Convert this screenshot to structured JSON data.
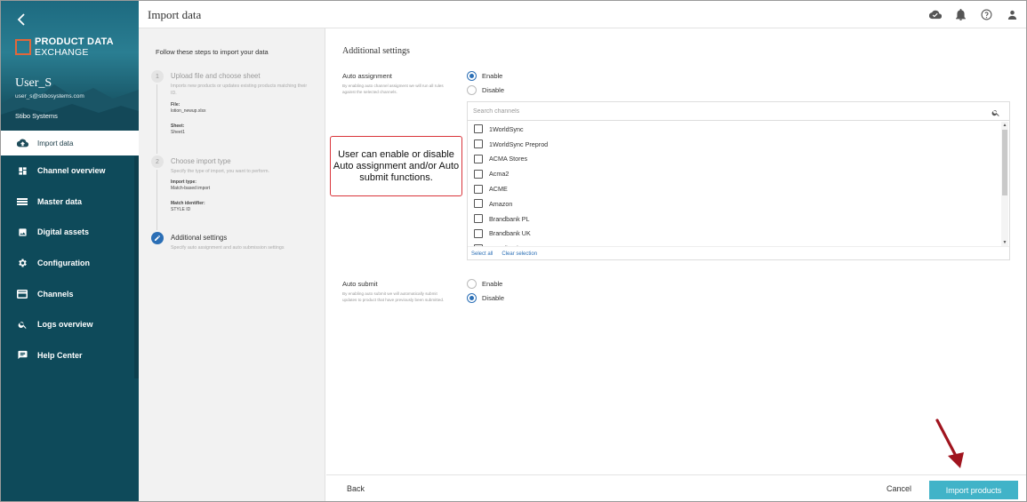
{
  "sidebar": {
    "logo": {
      "line1": "PRODUCT DATA",
      "line2": "EXCHANGE",
      "accent": "#e2673a"
    },
    "user": {
      "name": "User_S",
      "email": "user_s@stibosystems.com",
      "org": "Stibo Systems"
    },
    "items": [
      {
        "label": "Import data",
        "icon": "cloud-upload-icon",
        "active": true
      },
      {
        "label": "Channel overview",
        "icon": "dashboard-icon"
      },
      {
        "label": "Master data",
        "icon": "list-icon"
      },
      {
        "label": "Digital assets",
        "icon": "image-icon"
      },
      {
        "label": "Configuration",
        "icon": "gear-icon"
      },
      {
        "label": "Channels",
        "icon": "card-icon"
      },
      {
        "label": "Logs overview",
        "icon": "search-icon"
      },
      {
        "label": "Help Center",
        "icon": "chat-icon"
      }
    ]
  },
  "header": {
    "title": "Import data"
  },
  "steps": {
    "title": "Follow these steps to import your data",
    "items": [
      {
        "num": "1",
        "title": "Upload file and choose sheet",
        "desc": "Imports new products or updates existing products matching their ID.",
        "fields": [
          {
            "label": "File:",
            "value": "lotion_newup.xlsx"
          },
          {
            "label": "Sheet:",
            "value": "Sheet1"
          }
        ]
      },
      {
        "num": "2",
        "title": "Choose import type",
        "desc": "Specify the type of import, you want to perform.",
        "fields": [
          {
            "label": "Import type:",
            "value": "Match-based import"
          },
          {
            "label": "Match identifier:",
            "value": "STYLE ID"
          }
        ]
      },
      {
        "title": "Additional settings",
        "desc": "Specify auto assignment and auto submission settings"
      }
    ]
  },
  "main": {
    "section_title": "Additional settings",
    "auto_assignment": {
      "label": "Auto assignment",
      "desc": "By enabling auto channel assigment we will run all rules against the selected channels.",
      "enable_label": "Enable",
      "disable_label": "Disable",
      "selected": "enable"
    },
    "channels": {
      "search_placeholder": "Search channels",
      "items": [
        "1WorldSync",
        "1WorldSync Preprod",
        "ACMA Stores",
        "Acma2",
        "ACME",
        "Amazon",
        "Brandbank PL",
        "Brandbank UK",
        "Brandbank US"
      ],
      "select_all": "Select all",
      "clear_selection": "Clear selection"
    },
    "auto_submit": {
      "label": "Auto submit",
      "desc": "By enabling auto submit we will automatically submit updates to product that have previously been submitted.",
      "enable_label": "Enable",
      "disable_label": "Disable",
      "selected": "disable"
    }
  },
  "callout": {
    "text": "User can enable or disable Auto assignment and/or Auto submit functions.",
    "border_color": "#d9343a"
  },
  "footer": {
    "back": "Back",
    "cancel": "Cancel",
    "import": "Import products",
    "import_color": "#41b3c8"
  },
  "annotation_arrow": {
    "color": "#a0141e"
  }
}
